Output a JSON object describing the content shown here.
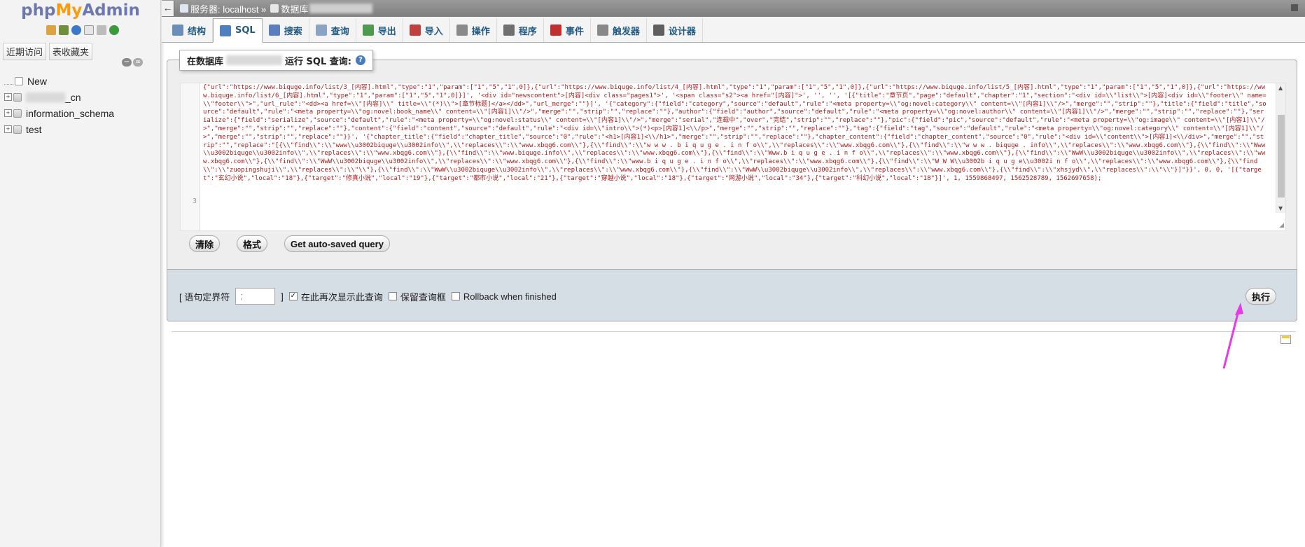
{
  "logo": {
    "part1": "php",
    "part2": "My",
    "part3": "Admin"
  },
  "nav": {
    "buttons": [
      "近期访问",
      "表收藏夹"
    ],
    "tree": [
      {
        "label": "New",
        "expandable": false
      },
      {
        "label": "_cn",
        "expandable": true
      },
      {
        "label": "information_schema",
        "expandable": true
      },
      {
        "label": "test",
        "expandable": true
      }
    ]
  },
  "breadcrumb": {
    "server": "服务器: localhost »",
    "database": "数据库"
  },
  "tabs": [
    {
      "label": "结构",
      "icon": "structure-icon",
      "color": "#6b8fb8"
    },
    {
      "label": "SQL",
      "icon": "sql-icon",
      "color": "#4f7fbf"
    },
    {
      "label": "搜索",
      "icon": "search-icon",
      "color": "#5a7fbf"
    },
    {
      "label": "查询",
      "icon": "query-icon",
      "color": "#8aa2c5"
    },
    {
      "label": "导出",
      "icon": "export-icon",
      "color": "#4f9a4f"
    },
    {
      "label": "导入",
      "icon": "import-icon",
      "color": "#c04040"
    },
    {
      "label": "操作",
      "icon": "wrench-icon",
      "color": "#8a8a8a"
    },
    {
      "label": "程序",
      "icon": "routines-icon",
      "color": "#707070"
    },
    {
      "label": "事件",
      "icon": "clock-icon",
      "color": "#c03030"
    },
    {
      "label": "触发器",
      "icon": "trigger-icon",
      "color": "#888888"
    },
    {
      "label": "设计器",
      "icon": "designer-icon",
      "color": "#606060"
    }
  ],
  "sql": {
    "legend_prefix": "在数据库",
    "legend_suffix": "运行 SQL 查询:",
    "line_numbers": [
      "3"
    ],
    "code": "{\"url\":\"https://www.biquge.info/list/3_[内容].html\",\"type\":\"1\",\"param\":[\"1\",\"5\",\"1\",0]},{\"url\":\"https://www.biquge.info/list/4_[内容].html\",\"type\":\"1\",\"param\":[\"1\",\"5\",\"1\",0]},{\"url\":\"https://www.biquge.info/list/5_[内容].html\",\"type\":\"1\",\"param\":[\"1\",\"5\",\"1\",0]},{\"url\":\"https://www.biquge.info/list/6_[内容].html\",\"type\":\"1\",\"param\":[\"1\",\"5\",\"1\",0]}]', '<div id=\"newscontent\">[内容]<div class=\"pages1\">', '<span class=\"s2\"><a href=\"[内容]\">', '', '', '[{\"title\":\"章节页\",\"page\":\"default\",\"chapter\":\"1\",\"section\":\"<div id=\\\\\"list\\\\\">[内容]<div id=\\\\\"footer\\\\\" name=\\\\\"footer\\\\\">\",\"url_rule\":\"<dd><a href=\\\\\"[内容]\\\\\" title=\\\\\"(*)\\\\\">[章节标题]</a></dd>\",\"url_merge\":\"\"}]', '{\"category\":{\"field\":\"category\",\"source\":\"default\",\"rule\":\"<meta property=\\\\\"og:novel:category\\\\\" content=\\\\\"[内容1]\\\\\"/>\",\"merge\":\"\",\"strip\":\"\"},\"title\":{\"field\":\"title\",\"source\":\"default\",\"rule\":\"<meta property=\\\\\"og:novel:book_name\\\\\" content=\\\\\"[内容1]\\\\\"/>\",\"merge\":\"\",\"strip\":\"\",\"replace\":\"\"},\"author\":{\"field\":\"author\",\"source\":\"default\",\"rule\":\"<meta property=\\\\\"og:novel:author\\\\\" content=\\\\\"[内容1]\\\\\"/>\",\"merge\":\"\",\"strip\":\"\",\"replace\":\"\"},\"serialize\":{\"field\":\"serialize\",\"source\":\"default\",\"rule\":\"<meta property=\\\\\"og:novel:status\\\\\" content=\\\\\"[内容1]\\\\\"/>\",\"merge\":\"serial\",\"连载中\",\"over\",\"完结\",\"strip\":\"\",\"replace\":\"\"},\"pic\":{\"field\":\"pic\",\"source\":\"default\",\"rule\":\"<meta property=\\\\\"og:image\\\\\" content=\\\\\"[内容1]\\\\\"/>\",\"merge\":\"\",\"strip\":\"\",\"replace\":\"\"},\"content\":{\"field\":\"content\",\"source\":\"default\",\"rule\":\"<div id=\\\\\"intro\\\\\">(*)<p>[内容1]<\\\\/p>\",\"merge\":\"\",\"strip\":\"\",\"replace\":\"\"},\"tag\":{\"field\":\"tag\",\"source\":\"default\",\"rule\":\"<meta property=\\\\\"og:novel:category\\\\\" content=\\\\\"[内容1]\\\\\"/>\",\"merge\":\"\",\"strip\":\"\",\"replace\":\"\"}}', '{\"chapter_title\":{\"field\":\"chapter_title\",\"source\":\"0\",\"rule\":\"<h1>[内容1]<\\\\/h1>\",\"merge\":\"\",\"strip\":\"\",\"replace\":\"\"},\"chapter_content\":{\"field\":\"chapter_content\",\"source\":\"0\",\"rule\":\"<div id=\\\\\"content\\\\\">[内容1]<\\\\/div>\",\"merge\":\"\",\"strip\":\"\",\"replace\":\"[{\\\\\"find\\\\\":\\\\\"www\\\\u3002biquge\\\\u3002info\\\\\",\\\\\"replaces\\\\\":\\\\\"www.xbqg6.com\\\\\"},{\\\\\"find\\\\\":\\\\\"w w w . b i q u g e . i n f o\\\\\",\\\\\"replaces\\\\\":\\\\\"www.xbqg6.com\\\\\"},{\\\\\"find\\\\\":\\\\\"w w w . biquge . info\\\\\",\\\\\"replaces\\\\\":\\\\\"www.xbqg6.com\\\\\"},{\\\\\"find\\\\\":\\\\\"Www\\\\u3002biquge\\\\u3002info\\\\\",\\\\\"replaces\\\\\":\\\\\"www.xbqg6.com\\\\\"},{\\\\\"find\\\\\":\\\\\"www.biquge.info\\\\\",\\\\\"replaces\\\\\":\\\\\"www.xbqg6.com\\\\\"},{\\\\\"find\\\\\":\\\\\"Www.b i q u g e . i n f o\\\\\",\\\\\"replaces\\\\\":\\\\\"www.xbqg6.com\\\\\"},{\\\\\"find\\\\\":\\\\\"WwW\\\\u3002biquge\\\\u3002info\\\\\",\\\\\"replaces\\\\\":\\\\\"www.xbqg6.com\\\\\"},{\\\\\"find\\\\\":\\\\\"WwW\\\\u3002biquge\\\\u3002info\\\\\",\\\\\"replaces\\\\\":\\\\\"www.xbqg6.com\\\\\"},{\\\\\"find\\\\\":\\\\\"www.b i q u g e . i n f o\\\\\",\\\\\"replaces\\\\\":\\\\\"www.xbqg6.com\\\\\"},{\\\\\"find\\\\\":\\\\\"W W W\\\\u3002b i q u g e\\\\u3002i n f o\\\\\",\\\\\"replaces\\\\\":\\\\\"www.xbqg6.com\\\\\"},{\\\\\"find\\\\\":\\\\\"zuopingshuji\\\\\",\\\\\"replaces\\\\\":\\\\\"\\\\\"},{\\\\\"find\\\\\":\\\\\"WwW\\\\u3002biquge\\\\u3002info\\\\\",\\\\\"replaces\\\\\":\\\\\"www.xbqg6.com\\\\\"},{\\\\\"find\\\\\":\\\\\"WwW\\\\u3002biquge\\\\u3002info\\\\\",\\\\\"replaces\\\\\":\\\\\"www.xbqg6.com\\\\\"},{\\\\\"find\\\\\":\\\\\"xhsjyd\\\\\",\\\\\"replaces\\\\\":\\\\\"\\\\\"}]\"}}', 0, 0, '[{\"target\":\"玄幻小说\",\"local\":\"18\"},{\"target\":\"修真小说\",\"local\":\"19\"},{\"target\":\"都市小说\",\"local\":\"21\"},{\"target\":\"穿越小说\",\"local\":\"18\"},{\"target\":\"网游小说\",\"local\":\"34\"},{\"target\":\"科幻小说\",\"local\":\"18\"}]', 1, 1559868497, 1562528789, 1562697658);"
  },
  "buttons": {
    "clear": "清除",
    "format": "格式",
    "autosave": "Get auto-saved query",
    "go": "执行"
  },
  "options": {
    "delimiter_label": "[ 语句定界符",
    "delimiter_value": ";",
    "delimiter_close": "]",
    "show_query_label": "在此再次显示此查询",
    "show_query_checked": true,
    "retain_box_label": "保留查询框",
    "retain_box_checked": false,
    "rollback_label": "Rollback when finished",
    "rollback_checked": false
  },
  "colors": {
    "accent": "#235a81",
    "code": "#a71d1d",
    "options_bg": "#d5dde5",
    "annotation": "#e63ae6"
  }
}
